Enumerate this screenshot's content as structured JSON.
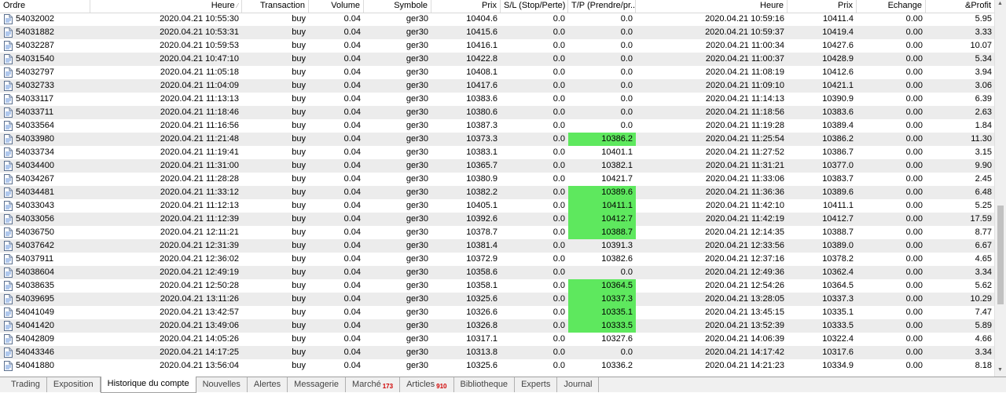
{
  "header": [
    "Ordre",
    "Heure",
    "Transaction",
    "Volume",
    "Symbole",
    "Prix",
    "S/L (Stop/Perte)",
    "T/P (Prendre/pr...",
    "Heure",
    "Prix",
    "Echange",
    "&Profit"
  ],
  "rows": [
    {
      "order": "54032002",
      "open": "2020.04.21 10:55:30",
      "type": "buy",
      "volume": "0.04",
      "symbol": "ger30",
      "price": "10404.6",
      "sl": "0.0",
      "tp": "0.0",
      "tp_hl": false,
      "close": "2020.04.21 10:59:16",
      "close_price": "10411.4",
      "swap": "0.00",
      "profit": "5.95"
    },
    {
      "order": "54031882",
      "open": "2020.04.21 10:53:31",
      "type": "buy",
      "volume": "0.04",
      "symbol": "ger30",
      "price": "10415.6",
      "sl": "0.0",
      "tp": "0.0",
      "tp_hl": false,
      "close": "2020.04.21 10:59:37",
      "close_price": "10419.4",
      "swap": "0.00",
      "profit": "3.33"
    },
    {
      "order": "54032287",
      "open": "2020.04.21 10:59:53",
      "type": "buy",
      "volume": "0.04",
      "symbol": "ger30",
      "price": "10416.1",
      "sl": "0.0",
      "tp": "0.0",
      "tp_hl": false,
      "close": "2020.04.21 11:00:34",
      "close_price": "10427.6",
      "swap": "0.00",
      "profit": "10.07"
    },
    {
      "order": "54031540",
      "open": "2020.04.21 10:47:10",
      "type": "buy",
      "volume": "0.04",
      "symbol": "ger30",
      "price": "10422.8",
      "sl": "0.0",
      "tp": "0.0",
      "tp_hl": false,
      "close": "2020.04.21 11:00:37",
      "close_price": "10428.9",
      "swap": "0.00",
      "profit": "5.34"
    },
    {
      "order": "54032797",
      "open": "2020.04.21 11:05:18",
      "type": "buy",
      "volume": "0.04",
      "symbol": "ger30",
      "price": "10408.1",
      "sl": "0.0",
      "tp": "0.0",
      "tp_hl": false,
      "close": "2020.04.21 11:08:19",
      "close_price": "10412.6",
      "swap": "0.00",
      "profit": "3.94"
    },
    {
      "order": "54032733",
      "open": "2020.04.21 11:04:09",
      "type": "buy",
      "volume": "0.04",
      "symbol": "ger30",
      "price": "10417.6",
      "sl": "0.0",
      "tp": "0.0",
      "tp_hl": false,
      "close": "2020.04.21 11:09:10",
      "close_price": "10421.1",
      "swap": "0.00",
      "profit": "3.06"
    },
    {
      "order": "54033117",
      "open": "2020.04.21 11:13:13",
      "type": "buy",
      "volume": "0.04",
      "symbol": "ger30",
      "price": "10383.6",
      "sl": "0.0",
      "tp": "0.0",
      "tp_hl": false,
      "close": "2020.04.21 11:14:13",
      "close_price": "10390.9",
      "swap": "0.00",
      "profit": "6.39"
    },
    {
      "order": "54033711",
      "open": "2020.04.21 11:18:46",
      "type": "buy",
      "volume": "0.04",
      "symbol": "ger30",
      "price": "10380.6",
      "sl": "0.0",
      "tp": "0.0",
      "tp_hl": false,
      "close": "2020.04.21 11:18:56",
      "close_price": "10383.6",
      "swap": "0.00",
      "profit": "2.63"
    },
    {
      "order": "54033564",
      "open": "2020.04.21 11:16:56",
      "type": "buy",
      "volume": "0.04",
      "symbol": "ger30",
      "price": "10387.3",
      "sl": "0.0",
      "tp": "0.0",
      "tp_hl": false,
      "close": "2020.04.21 11:19:28",
      "close_price": "10389.4",
      "swap": "0.00",
      "profit": "1.84"
    },
    {
      "order": "54033980",
      "open": "2020.04.21 11:21:48",
      "type": "buy",
      "volume": "0.04",
      "symbol": "ger30",
      "price": "10373.3",
      "sl": "0.0",
      "tp": "10386.2",
      "tp_hl": true,
      "close": "2020.04.21 11:25:54",
      "close_price": "10386.2",
      "swap": "0.00",
      "profit": "11.30"
    },
    {
      "order": "54033734",
      "open": "2020.04.21 11:19:41",
      "type": "buy",
      "volume": "0.04",
      "symbol": "ger30",
      "price": "10383.1",
      "sl": "0.0",
      "tp": "10401.1",
      "tp_hl": false,
      "close": "2020.04.21 11:27:52",
      "close_price": "10386.7",
      "swap": "0.00",
      "profit": "3.15"
    },
    {
      "order": "54034400",
      "open": "2020.04.21 11:31:00",
      "type": "buy",
      "volume": "0.04",
      "symbol": "ger30",
      "price": "10365.7",
      "sl": "0.0",
      "tp": "10382.1",
      "tp_hl": false,
      "close": "2020.04.21 11:31:21",
      "close_price": "10377.0",
      "swap": "0.00",
      "profit": "9.90"
    },
    {
      "order": "54034267",
      "open": "2020.04.21 11:28:28",
      "type": "buy",
      "volume": "0.04",
      "symbol": "ger30",
      "price": "10380.9",
      "sl": "0.0",
      "tp": "10421.7",
      "tp_hl": false,
      "close": "2020.04.21 11:33:06",
      "close_price": "10383.7",
      "swap": "0.00",
      "profit": "2.45"
    },
    {
      "order": "54034481",
      "open": "2020.04.21 11:33:12",
      "type": "buy",
      "volume": "0.04",
      "symbol": "ger30",
      "price": "10382.2",
      "sl": "0.0",
      "tp": "10389.6",
      "tp_hl": true,
      "close": "2020.04.21 11:36:36",
      "close_price": "10389.6",
      "swap": "0.00",
      "profit": "6.48"
    },
    {
      "order": "54033043",
      "open": "2020.04.21 11:12:13",
      "type": "buy",
      "volume": "0.04",
      "symbol": "ger30",
      "price": "10405.1",
      "sl": "0.0",
      "tp": "10411.1",
      "tp_hl": true,
      "close": "2020.04.21 11:42:10",
      "close_price": "10411.1",
      "swap": "0.00",
      "profit": "5.25"
    },
    {
      "order": "54033056",
      "open": "2020.04.21 11:12:39",
      "type": "buy",
      "volume": "0.04",
      "symbol": "ger30",
      "price": "10392.6",
      "sl": "0.0",
      "tp": "10412.7",
      "tp_hl": true,
      "close": "2020.04.21 11:42:19",
      "close_price": "10412.7",
      "swap": "0.00",
      "profit": "17.59"
    },
    {
      "order": "54036750",
      "open": "2020.04.21 12:11:21",
      "type": "buy",
      "volume": "0.04",
      "symbol": "ger30",
      "price": "10378.7",
      "sl": "0.0",
      "tp": "10388.7",
      "tp_hl": true,
      "close": "2020.04.21 12:14:35",
      "close_price": "10388.7",
      "swap": "0.00",
      "profit": "8.77"
    },
    {
      "order": "54037642",
      "open": "2020.04.21 12:31:39",
      "type": "buy",
      "volume": "0.04",
      "symbol": "ger30",
      "price": "10381.4",
      "sl": "0.0",
      "tp": "10391.3",
      "tp_hl": false,
      "close": "2020.04.21 12:33:56",
      "close_price": "10389.0",
      "swap": "0.00",
      "profit": "6.67"
    },
    {
      "order": "54037911",
      "open": "2020.04.21 12:36:02",
      "type": "buy",
      "volume": "0.04",
      "symbol": "ger30",
      "price": "10372.9",
      "sl": "0.0",
      "tp": "10382.6",
      "tp_hl": false,
      "close": "2020.04.21 12:37:16",
      "close_price": "10378.2",
      "swap": "0.00",
      "profit": "4.65"
    },
    {
      "order": "54038604",
      "open": "2020.04.21 12:49:19",
      "type": "buy",
      "volume": "0.04",
      "symbol": "ger30",
      "price": "10358.6",
      "sl": "0.0",
      "tp": "0.0",
      "tp_hl": false,
      "close": "2020.04.21 12:49:36",
      "close_price": "10362.4",
      "swap": "0.00",
      "profit": "3.34"
    },
    {
      "order": "54038635",
      "open": "2020.04.21 12:50:28",
      "type": "buy",
      "volume": "0.04",
      "symbol": "ger30",
      "price": "10358.1",
      "sl": "0.0",
      "tp": "10364.5",
      "tp_hl": true,
      "close": "2020.04.21 12:54:26",
      "close_price": "10364.5",
      "swap": "0.00",
      "profit": "5.62"
    },
    {
      "order": "54039695",
      "open": "2020.04.21 13:11:26",
      "type": "buy",
      "volume": "0.04",
      "symbol": "ger30",
      "price": "10325.6",
      "sl": "0.0",
      "tp": "10337.3",
      "tp_hl": true,
      "close": "2020.04.21 13:28:05",
      "close_price": "10337.3",
      "swap": "0.00",
      "profit": "10.29"
    },
    {
      "order": "54041049",
      "open": "2020.04.21 13:42:57",
      "type": "buy",
      "volume": "0.04",
      "symbol": "ger30",
      "price": "10326.6",
      "sl": "0.0",
      "tp": "10335.1",
      "tp_hl": true,
      "close": "2020.04.21 13:45:15",
      "close_price": "10335.1",
      "swap": "0.00",
      "profit": "7.47"
    },
    {
      "order": "54041420",
      "open": "2020.04.21 13:49:06",
      "type": "buy",
      "volume": "0.04",
      "symbol": "ger30",
      "price": "10326.8",
      "sl": "0.0",
      "tp": "10333.5",
      "tp_hl": true,
      "close": "2020.04.21 13:52:39",
      "close_price": "10333.5",
      "swap": "0.00",
      "profit": "5.89"
    },
    {
      "order": "54042809",
      "open": "2020.04.21 14:05:26",
      "type": "buy",
      "volume": "0.04",
      "symbol": "ger30",
      "price": "10317.1",
      "sl": "0.0",
      "tp": "10327.6",
      "tp_hl": false,
      "close": "2020.04.21 14:06:39",
      "close_price": "10322.4",
      "swap": "0.00",
      "profit": "4.66"
    },
    {
      "order": "54043346",
      "open": "2020.04.21 14:17:25",
      "type": "buy",
      "volume": "0.04",
      "symbol": "ger30",
      "price": "10313.8",
      "sl": "0.0",
      "tp": "0.0",
      "tp_hl": false,
      "close": "2020.04.21 14:17:42",
      "close_price": "10317.6",
      "swap": "0.00",
      "profit": "3.34"
    },
    {
      "order": "54041880",
      "open": "2020.04.21 13:56:04",
      "type": "buy",
      "volume": "0.04",
      "symbol": "ger30",
      "price": "10325.6",
      "sl": "0.0",
      "tp": "10336.2",
      "tp_hl": false,
      "close": "2020.04.21 14:21:23",
      "close_price": "10334.9",
      "swap": "0.00",
      "profit": "8.18"
    }
  ],
  "tabs": [
    {
      "label": "Trading",
      "active": false,
      "badge": ""
    },
    {
      "label": "Exposition",
      "active": false,
      "badge": ""
    },
    {
      "label": "Historique du compte",
      "active": true,
      "badge": ""
    },
    {
      "label": "Nouvelles",
      "active": false,
      "badge": ""
    },
    {
      "label": "Alertes",
      "active": false,
      "badge": ""
    },
    {
      "label": "Messagerie",
      "active": false,
      "badge": ""
    },
    {
      "label": "Marché",
      "active": false,
      "badge": "173"
    },
    {
      "label": "Articles",
      "active": false,
      "badge": "910"
    },
    {
      "label": "Bibliotheque",
      "active": false,
      "badge": ""
    },
    {
      "label": "Experts",
      "active": false,
      "badge": ""
    },
    {
      "label": "Journal",
      "active": false,
      "badge": ""
    }
  ],
  "colors": {
    "tp_highlight": "#5ee85e",
    "row_alt": "#ececec",
    "tab_badge": "#d00000"
  },
  "icons": {
    "order": "document-icon",
    "sort": "sort-indicator-icon"
  }
}
